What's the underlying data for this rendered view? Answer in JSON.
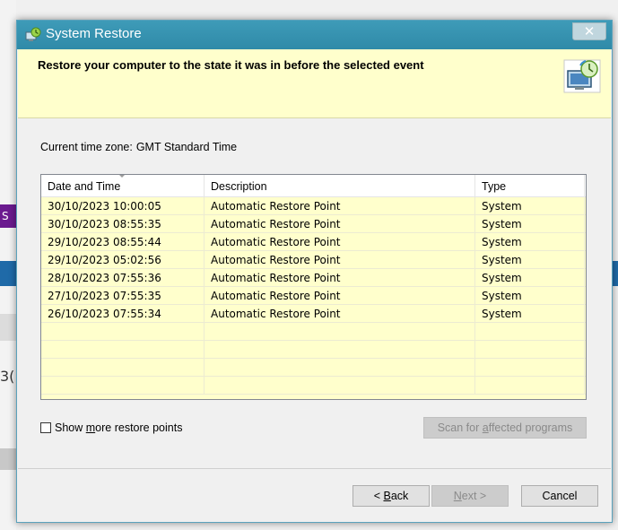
{
  "window": {
    "title": "System Restore",
    "close_glyph": "✕"
  },
  "header": {
    "heading": "Restore your computer to the state it was in before the selected event"
  },
  "timezone": {
    "label": "Current time zone:",
    "value": "GMT Standard Time"
  },
  "table": {
    "columns": [
      "Date and Time",
      "Description",
      "Type"
    ],
    "rows": [
      [
        "30/10/2023 10:00:05",
        "Automatic Restore Point",
        "System"
      ],
      [
        "30/10/2023 08:55:35",
        "Automatic Restore Point",
        "System"
      ],
      [
        "29/10/2023 08:55:44",
        "Automatic Restore Point",
        "System"
      ],
      [
        "29/10/2023 05:02:56",
        "Automatic Restore Point",
        "System"
      ],
      [
        "28/10/2023 07:55:36",
        "Automatic Restore Point",
        "System"
      ],
      [
        "27/10/2023 07:55:35",
        "Automatic Restore Point",
        "System"
      ],
      [
        "26/10/2023 07:55:34",
        "Automatic Restore Point",
        "System"
      ]
    ]
  },
  "options": {
    "show_more_pre": "Show ",
    "show_more_key": "m",
    "show_more_post": "ore restore points",
    "show_more_checked": false
  },
  "buttons": {
    "scan_pre": "Scan for ",
    "scan_key": "a",
    "scan_post": "ffected programs",
    "back_pre": "< ",
    "back_key": "B",
    "back_post": "ack",
    "next_key": "N",
    "next_post": "ext >",
    "cancel": "Cancel"
  },
  "background": {
    "purple_tab_letter": "S",
    "side_text": "3("
  },
  "colors": {
    "titlebar": "#3e9bb8",
    "header_band": "#ffffcc",
    "list_background": "#ffffcc"
  }
}
